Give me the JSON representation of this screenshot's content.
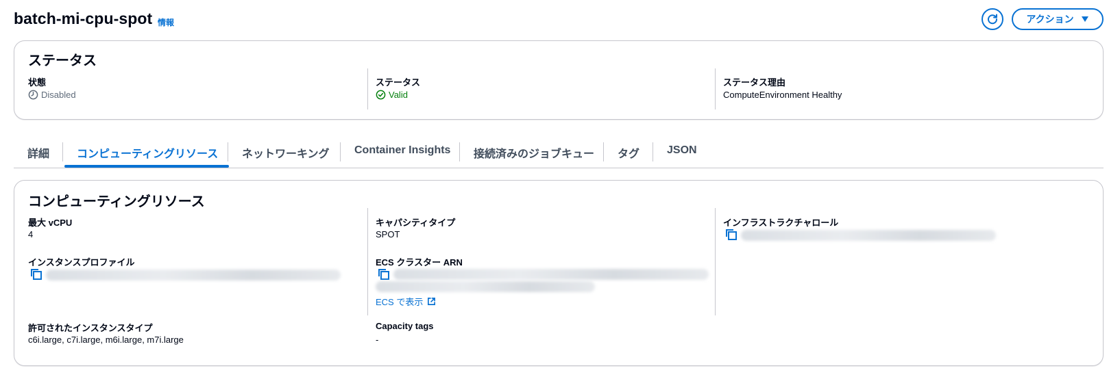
{
  "header": {
    "title": "batch-mi-cpu-spot",
    "info_link": "情報",
    "refresh_icon": "refresh-icon",
    "actions_label": "アクション"
  },
  "status_panel": {
    "title": "ステータス",
    "state_label": "状態",
    "state_value": "Disabled",
    "state_icon": "clock-icon",
    "status_label": "ステータス",
    "status_value": "Valid",
    "status_icon": "check-circle-icon",
    "reason_label": "ステータス理由",
    "reason_value": "ComputeEnvironment Healthy"
  },
  "tabs": [
    {
      "label": "詳細",
      "active": false
    },
    {
      "label": "コンピューティングリソース",
      "active": true
    },
    {
      "label": "ネットワーキング",
      "active": false
    },
    {
      "label": "Container Insights",
      "active": false
    },
    {
      "label": "接続済みのジョブキュー",
      "active": false
    },
    {
      "label": "タグ",
      "active": false
    },
    {
      "label": "JSON",
      "active": false
    }
  ],
  "resources_panel": {
    "title": "コンピューティングリソース",
    "max_vcpu_label": "最大 vCPU",
    "max_vcpu_value": "4",
    "capacity_type_label": "キャパシティタイプ",
    "capacity_type_value": "SPOT",
    "infra_role_label": "インフラストラクチャロール",
    "instance_profile_label": "インスタンスプロファイル",
    "ecs_cluster_label": "ECS クラスター ARN",
    "ecs_link_label": "ECS で表示",
    "allowed_types_label": "許可されたインスタンスタイプ",
    "allowed_types_value": "c6i.large, c7i.large, m6i.large, m7i.large",
    "capacity_tags_label": "Capacity tags",
    "capacity_tags_value": "-"
  },
  "colors": {
    "accent": "#0972d3",
    "success": "#037f0c",
    "muted": "#5f6b7a",
    "border": "#c6c6cd"
  }
}
